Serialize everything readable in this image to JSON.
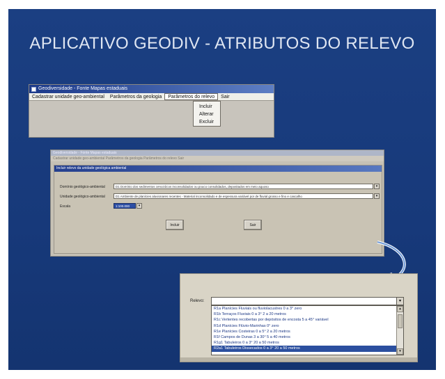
{
  "slide": {
    "title": "APLICATIVO GEODIV - ATRIBUTOS DO RELEVO"
  },
  "window1": {
    "title": "Geodiversidade - Fonte Mapas estaduais",
    "menu": [
      "Cadastrar unidade geo-ambiental",
      "Parâmetros da geologia",
      "Parâmetros do relevo",
      "Sair"
    ],
    "dropdown": [
      "Incluir",
      "Alterar",
      "Excluir"
    ]
  },
  "window2": {
    "title": "Geodiversidade - Fonte Mapas estaduais",
    "menu": "Cadastrar unidade geo-ambiental   Parâmetros da geologia   Parâmetros do relevo   Sair",
    "dialog_title": "Incluir relevo da unidade geológica ambiental",
    "form": {
      "label1": "Domínio geológico-ambiental",
      "value1": "D1 Domínio dos sedimentos cenozóicos inconsolidados ou pouco consolidados, depositados em meio aquoso",
      "label2": "Unidade geológico-ambiental",
      "value2": "D1 Ambiente de planícies aluvionares recentes - Material inconsolidado e de espessura variável por de fluvial grosso e fino e cascalho",
      "label3": "Escala",
      "value3": "1:100.000"
    },
    "buttons": [
      "Incluir",
      "Sair"
    ]
  },
  "panel3": {
    "label": "Relevo:",
    "combo_value": "",
    "options": [
      "R1a Planícies Fluviais ou fluviolacustres 0 a 3° zero",
      "R1b Terraços Fluviais 0 a 3° 2 a 20 metros",
      "R1c Vertentes recobertas por depósitos de encosta 5 a 45° variável",
      "R1d Planícies Flúvio-Marinhas 0° zero",
      "R1e Planícies Costeiras 0 a 5° 2 a 20 metros",
      "R1f Campos de Dunas 3 a 30° 5 a 40 metros",
      "R1g1 Tabuleiros 0 a 3° 20 a 50 metros",
      "R2a1 Tabuleiros Dissecados 0 a 3° 20 a 50 metros"
    ],
    "selected_index": 7
  },
  "colors": {
    "slide_bg": "#1b3f82",
    "title_text": "#dfe6f2",
    "arrow": "#ffffff",
    "selection": "#2b4f9f"
  }
}
